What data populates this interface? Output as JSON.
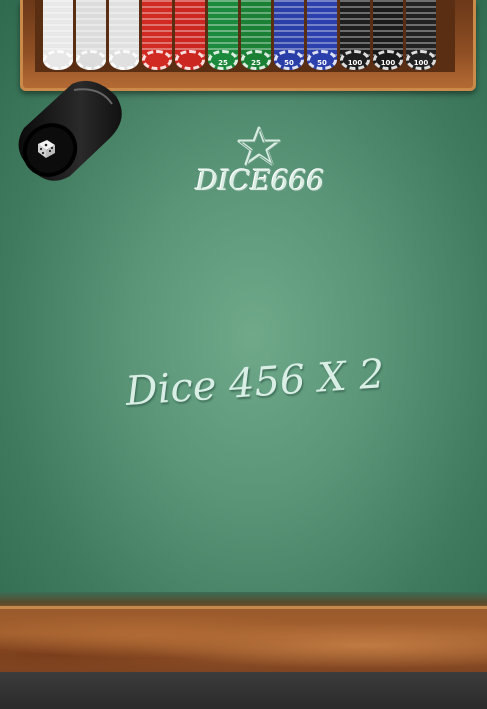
{
  "logo": {
    "text": "DICE666"
  },
  "message": {
    "text": "Dice 456 X 2"
  },
  "chips": [
    {
      "color": "#e8e8e8",
      "label": ""
    },
    {
      "color": "#dcdcdc",
      "label": ""
    },
    {
      "color": "#e0e0e0",
      "label": ""
    },
    {
      "color": "#d02a22",
      "label": ""
    },
    {
      "color": "#cc2620",
      "label": ""
    },
    {
      "color": "#1c8a3c",
      "label": "25"
    },
    {
      "color": "#198034",
      "label": "25"
    },
    {
      "color": "#2a3ea8",
      "label": "50"
    },
    {
      "color": "#2b40ac",
      "label": "50"
    },
    {
      "color": "#1e1e1e",
      "label": "100"
    },
    {
      "color": "#1a1a1a",
      "label": "100"
    },
    {
      "color": "#222222",
      "label": "100"
    }
  ],
  "colors": {
    "felt": "#5a9578",
    "wood": "#9b5a2c",
    "logo_text": "#d8ece2"
  },
  "icons": {
    "cup": "dice-cup-icon",
    "die": "die-icon",
    "star": "star-icon"
  }
}
